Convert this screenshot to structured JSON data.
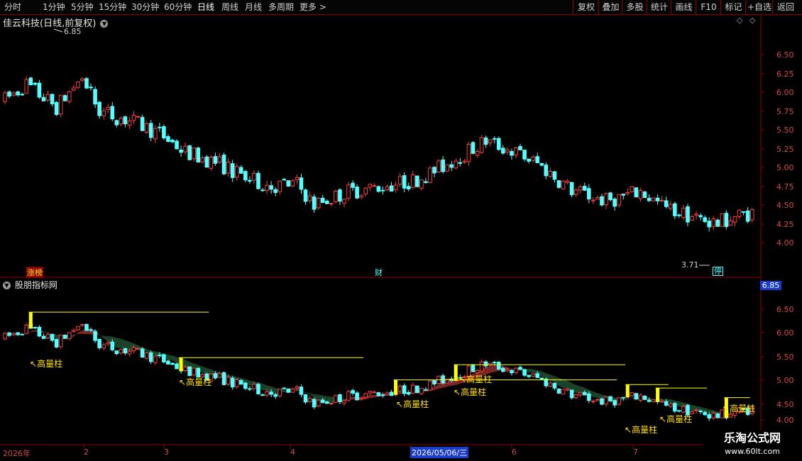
{
  "toolbar": {
    "periods": [
      "分时",
      "1分钟",
      "5分钟",
      "15分钟",
      "30分钟",
      "60分钟",
      "日线",
      "周线",
      "月线",
      "多周期",
      "更多"
    ],
    "active_period": "日线",
    "right_buttons": [
      "复权",
      "叠加",
      "多股",
      "统计",
      "画线",
      "F10",
      "标记",
      "+自选",
      "返回"
    ]
  },
  "main_panel": {
    "title": "佳云科技(日线,前复权)",
    "high_label": "6.85",
    "low_label": "3.71",
    "markers": [
      "涨榜",
      "财",
      "停"
    ],
    "y_ticks": [
      "6.50",
      "6.25",
      "6.00",
      "5.75",
      "5.50",
      "5.25",
      "5.00",
      "4.75",
      "4.50",
      "4.25",
      "4.00"
    ]
  },
  "indicator_panel": {
    "title": "股朋指标网",
    "value_box": "6.85",
    "signal_label": "高量柱",
    "y_ticks": [
      "6.50",
      "6.00",
      "5.50",
      "5.00",
      "4.50",
      "4.00"
    ]
  },
  "x_axis": {
    "labels": [
      "2026年",
      "2",
      "3",
      "4",
      "2026/05/06/三",
      "6",
      "7"
    ]
  },
  "watermark": {
    "title": "乐淘公式网",
    "url": "www.60lt.com"
  },
  "colors": {
    "up": "#ff3c3c",
    "down": "#54ffff",
    "grid": "#8b0000",
    "signal": "#ffff00"
  }
}
